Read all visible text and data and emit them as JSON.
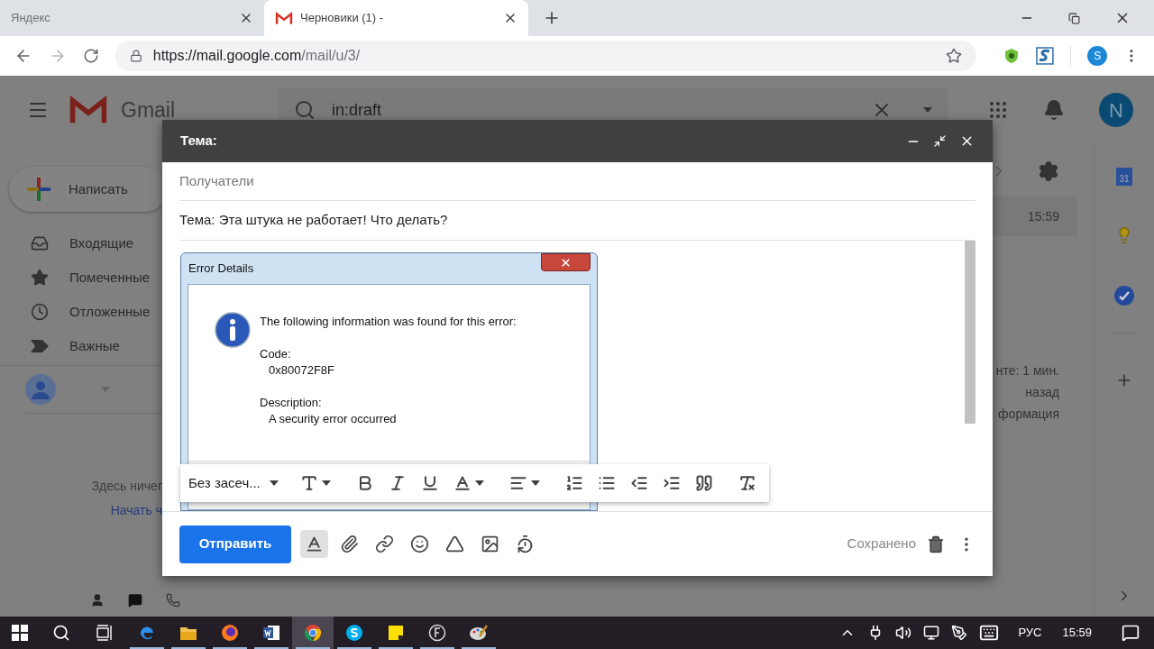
{
  "browser": {
    "tabs": [
      {
        "title": "Яндекс",
        "selected": false,
        "kind": "plain"
      },
      {
        "title": "Черновики (1) -",
        "selected": true,
        "kind": "gmail"
      }
    ],
    "url_host": "https://mail.google.com",
    "url_path": "/mail/u/3/",
    "profile": "S"
  },
  "gmail": {
    "logo": "Gmail",
    "search": "in:draft",
    "avatar": "N",
    "compose": "Написать",
    "nav": [
      {
        "label": "Входящие",
        "kind": "inbox"
      },
      {
        "label": "Помеченные",
        "kind": "starred"
      },
      {
        "label": "Отложенные",
        "kind": "snoozed"
      },
      {
        "label": "Важные",
        "kind": "important"
      }
    ],
    "empty_text": "Здесь ничег",
    "start_link": "Начать ч",
    "row_time": "15:59",
    "activity": [
      "нте: 1 мин.",
      "назад",
      "формация"
    ],
    "calendar_day": "31"
  },
  "compose": {
    "title": "Тема:",
    "recipients_placeholder": "Получатели",
    "subject": "Тема: Эта штука не работает! Что делать?",
    "attachment": {
      "title": "Error Details",
      "message": "The following information was found for this error:",
      "code_label": "Code:",
      "code": "0x80072F8F",
      "description_label": "Description:",
      "description": "A security error occurred"
    },
    "toolbar": [
      {
        "kind": "font",
        "label": "Без засеч..."
      },
      {
        "kind": "size"
      },
      {
        "kind": "bold"
      },
      {
        "kind": "italic"
      },
      {
        "kind": "underline"
      },
      {
        "kind": "color"
      },
      {
        "kind": "align"
      },
      {
        "kind": "numbered"
      },
      {
        "kind": "bulleted"
      },
      {
        "kind": "outdent"
      },
      {
        "kind": "indent"
      },
      {
        "kind": "quote"
      },
      {
        "kind": "clear"
      }
    ],
    "send": "Отправить",
    "actions": [
      {
        "kind": "format",
        "selected": true
      },
      {
        "kind": "attach",
        "selected": false
      },
      {
        "kind": "link",
        "selected": false
      },
      {
        "kind": "emoji",
        "selected": false
      },
      {
        "kind": "drive",
        "selected": false
      },
      {
        "kind": "photo",
        "selected": false
      },
      {
        "kind": "confidential",
        "selected": false
      }
    ],
    "saved": "Сохранено"
  },
  "taskbar": {
    "apps": [
      {
        "kind": "edge",
        "running": true,
        "selected": false
      },
      {
        "kind": "explorer",
        "running": true,
        "selected": false
      },
      {
        "kind": "firefox",
        "running": true,
        "selected": false
      },
      {
        "kind": "word",
        "running": true,
        "selected": false
      },
      {
        "kind": "chrome",
        "running": true,
        "selected": true
      },
      {
        "kind": "skype",
        "running": true,
        "selected": false
      },
      {
        "kind": "sticky",
        "running": true,
        "selected": false
      },
      {
        "kind": "f-app",
        "running": true,
        "selected": false
      },
      {
        "kind": "paint",
        "running": true,
        "selected": false
      }
    ],
    "language": "РУС",
    "time": "15:59"
  }
}
